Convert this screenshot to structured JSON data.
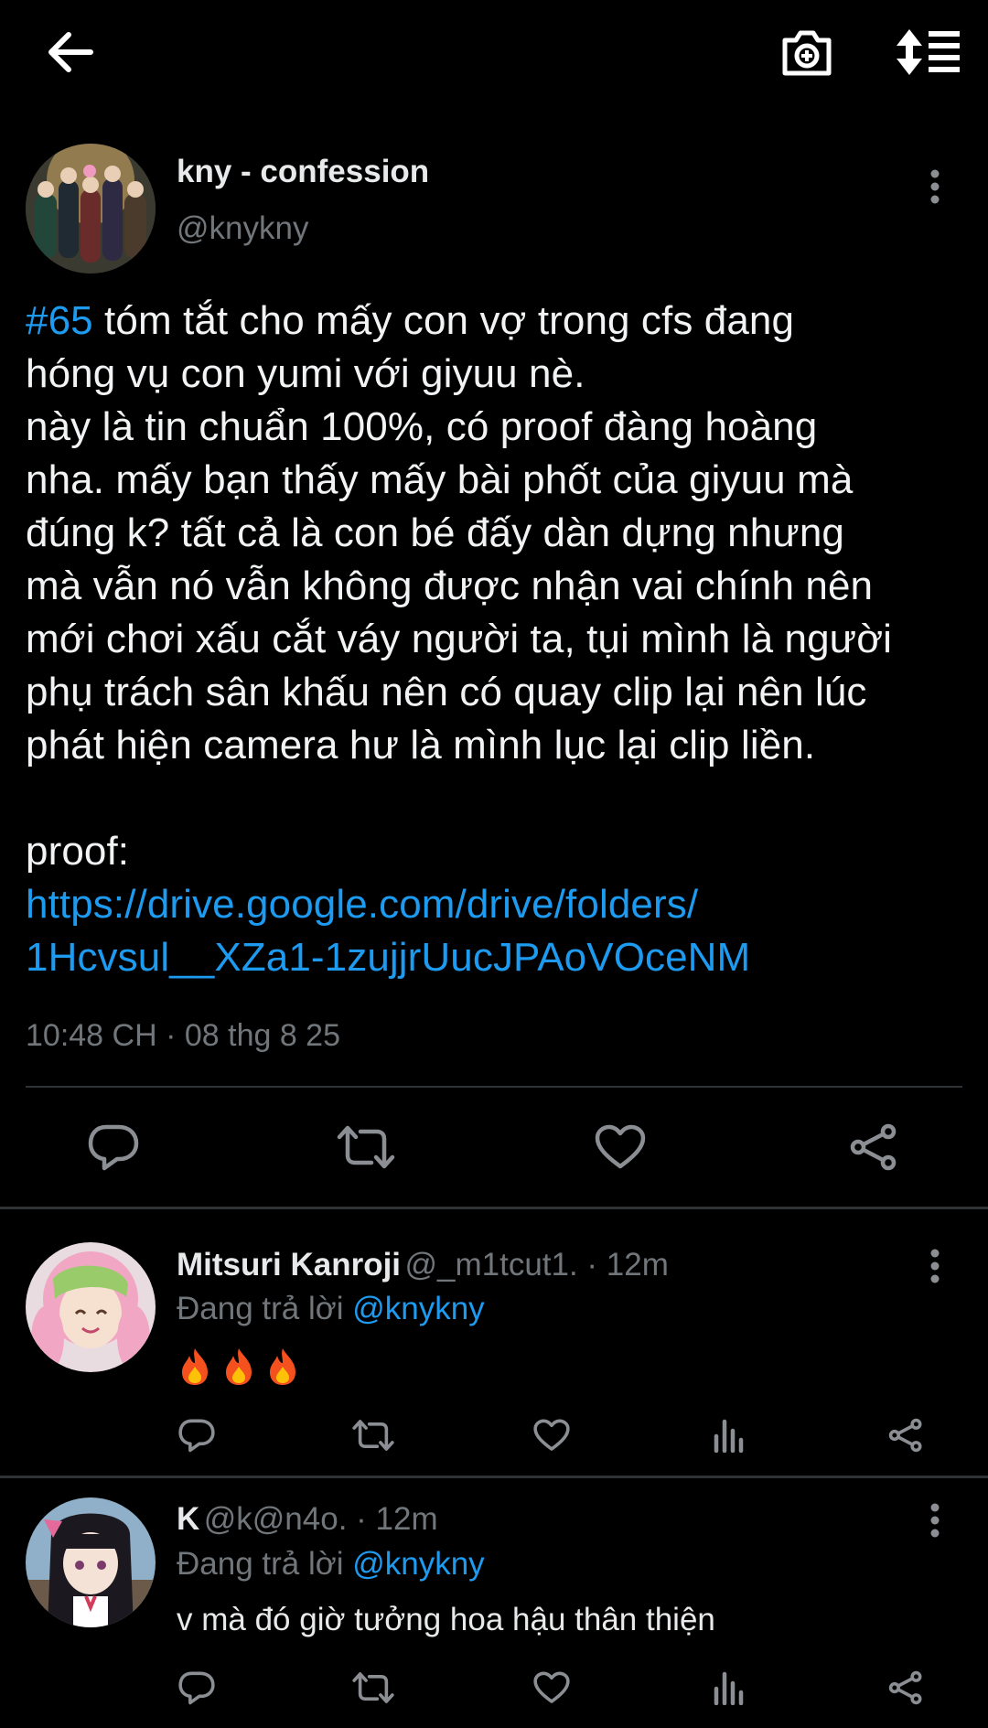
{
  "colors": {
    "background": "#000000",
    "text": "#e7e9ea",
    "muted": "#71767b",
    "link": "#1d9bf0",
    "divider": "#2f3336"
  },
  "topbar": {
    "icons": [
      "back-arrow-icon",
      "add-photo-icon",
      "sort-icon"
    ]
  },
  "tweet": {
    "display_name": "kny - confession",
    "handle": "@knykny",
    "hashtag": "#65",
    "text_intro": " tóm tắt cho mấy con vợ trong cfs đang\nhóng vụ con yumi với giyuu nè.\nnày là tin chuẩn 100%, có proof đàng hoàng\nnha. mấy bạn thấy mấy bài phốt của giyuu mà\nđúng k? tất cả là con bé đấy dàn dựng nhưng\nmà vẫn nó vẫn không được nhận vai chính nên\nmới chơi xấu cắt váy người ta, tụi mình là người\nphụ trách sân khấu nên có quay clip lại nên lúc\nphát hiện camera hư là mình lục lại clip liền.\n\nproof:\n",
    "link": "https://drive.google.com/drive/folders/\n1Hcvsul__XZa1-1zujjrUucJPAoVOceNM",
    "timestamp": "10:48 CH · 08 thg 8 25",
    "actions": [
      "reply-icon",
      "retweet-icon",
      "like-icon",
      "share-icon"
    ]
  },
  "replies": [
    {
      "display_name": "Mitsuri Kanroji",
      "meta": "@_m1tcut1. · 12m",
      "replying_prefix": "Đang trả lời ",
      "replying_to": "@knykny",
      "text": "",
      "emoji": [
        "fire-emoji",
        "fire-emoji",
        "fire-emoji"
      ]
    },
    {
      "display_name": "K",
      "meta": "@k@n4o. · 12m",
      "replying_prefix": "Đang trả lời ",
      "replying_to": "@knykny",
      "text": "v mà đó giờ tưởng hoa hậu thân thiện"
    }
  ]
}
